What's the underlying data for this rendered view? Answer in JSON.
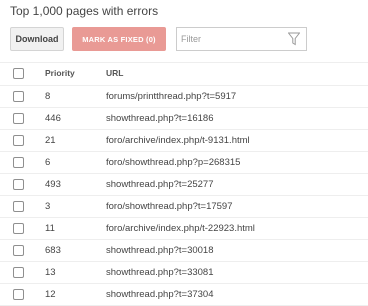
{
  "heading": "Top 1,000 pages with errors",
  "toolbar": {
    "download_label": "Download",
    "mark_fixed_label": "MARK AS FIXED (0)",
    "filter_placeholder": "Filter"
  },
  "table": {
    "columns": {
      "priority": "Priority",
      "url": "URL"
    },
    "rows": [
      {
        "priority": "8",
        "url": "forums/printthread.php?t=5917"
      },
      {
        "priority": "446",
        "url": "showthread.php?t=16186"
      },
      {
        "priority": "21",
        "url": "foro/archive/index.php/t-9131.html"
      },
      {
        "priority": "6",
        "url": "foro/showthread.php?p=268315"
      },
      {
        "priority": "493",
        "url": "showthread.php?t=25277"
      },
      {
        "priority": "3",
        "url": "foro/showthread.php?t=17597"
      },
      {
        "priority": "11",
        "url": "foro/archive/index.php/t-22923.html"
      },
      {
        "priority": "683",
        "url": "showthread.php?t=30018"
      },
      {
        "priority": "13",
        "url": "showthread.php?t=33081"
      },
      {
        "priority": "12",
        "url": "showthread.php?t=37304"
      }
    ]
  },
  "colors": {
    "mark_fixed_bg": "#e99a95",
    "download_bg": "#f1f1f1"
  },
  "icons": {
    "filter": "funnel-icon"
  }
}
